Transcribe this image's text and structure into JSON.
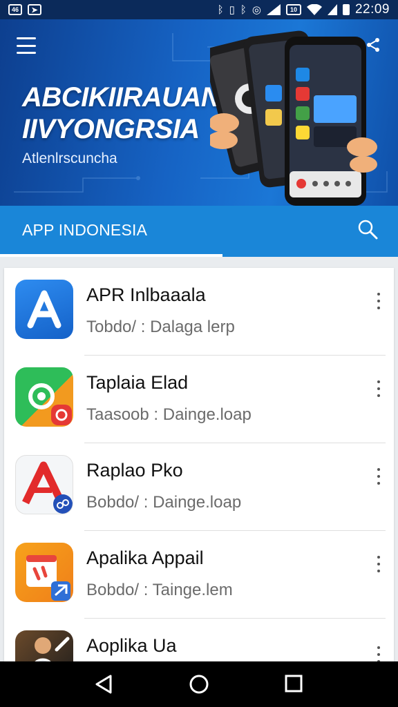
{
  "status_bar": {
    "left_icons": [
      "sim-card-icon",
      "message-icon"
    ],
    "right_icons": [
      "bluetooth-icon",
      "vibrate-icon",
      "bluetooth-alt-icon",
      "data-saver-icon",
      "signal-icon",
      "volte-icon",
      "wifi-icon",
      "battery-icon"
    ],
    "time": "22:09",
    "sim_label": "46",
    "volte_label": "10"
  },
  "banner": {
    "title_line1": "ABCIKIIRAUAN",
    "title_line2": "IIVYONGRSIA",
    "subtitle": "Atlenlrscuncha",
    "menu_icon": "hamburger-menu-icon",
    "share_icon": "share-icon"
  },
  "title_bar": {
    "label": "APP INDONESIA",
    "search_icon": "search-icon"
  },
  "apps": [
    {
      "name": "APR Inlbaaala",
      "desc": "Tobdo/ : Dalaga lerp"
    },
    {
      "name": "Taplaia Elad",
      "desc": "Taasoob : Dainge.loap"
    },
    {
      "name": "Raplao Pko",
      "desc": "Bobdo/ : Dainge.loap"
    },
    {
      "name": "Apalika Appail",
      "desc": "Bobdo/ : Tainge.lem"
    },
    {
      "name": "Aoplika Ua",
      "desc": ""
    }
  ],
  "nav_bar": {
    "back_icon": "back-icon",
    "home_icon": "home-icon",
    "recents_icon": "recents-icon"
  },
  "colors": {
    "title_bar": "#1a86d8",
    "banner_dark": "#0d3f8f",
    "status_bar": "#0b2a5a"
  }
}
